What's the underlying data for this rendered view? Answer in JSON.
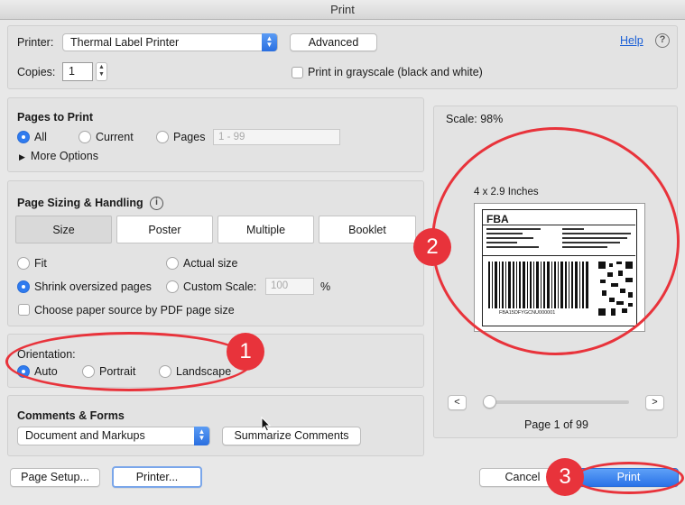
{
  "window": {
    "title": "Print"
  },
  "header": {
    "printer_label": "Printer:",
    "printer_value": "Thermal Label Printer",
    "advanced_label": "Advanced",
    "help_label": "Help",
    "help_icon": "?",
    "copies_label": "Copies:",
    "copies_value": "1",
    "grayscale_label": "Print in grayscale (black and white)"
  },
  "pages_to_print": {
    "title": "Pages to Print",
    "all": "All",
    "current": "Current",
    "pages": "Pages",
    "pages_placeholder": "1 - 99",
    "more_options": "More Options"
  },
  "sizing": {
    "title": "Page Sizing & Handling",
    "info_icon": "i",
    "tabs": [
      "Size",
      "Poster",
      "Multiple",
      "Booklet"
    ],
    "fit": "Fit",
    "actual_size": "Actual size",
    "shrink": "Shrink oversized pages",
    "custom_scale": "Custom Scale:",
    "custom_scale_value": "100",
    "percent": "%",
    "paper_source": "Choose paper source by PDF page size"
  },
  "orientation": {
    "title": "Orientation:",
    "auto": "Auto",
    "portrait": "Portrait",
    "landscape": "Landscape"
  },
  "comments": {
    "title": "Comments & Forms",
    "select_value": "Document and Markups",
    "summarize_label": "Summarize Comments"
  },
  "preview": {
    "scale_label": "Scale:  98%",
    "size_label": "4 x 2.9 Inches",
    "label_title": "FBA",
    "label_code": "FBA15DFYGCNU000001",
    "prev_label": "<",
    "next_label": ">",
    "page_label": "Page 1 of 99",
    "slider_position": 0
  },
  "footer": {
    "page_setup": "Page Setup...",
    "printer": "Printer...",
    "cancel": "Cancel",
    "print": "Print"
  },
  "annotations": [
    "1",
    "2",
    "3"
  ],
  "colors": {
    "accent": "#2f7bef",
    "annotation": "#e8333b",
    "link": "#1a5fd6"
  }
}
